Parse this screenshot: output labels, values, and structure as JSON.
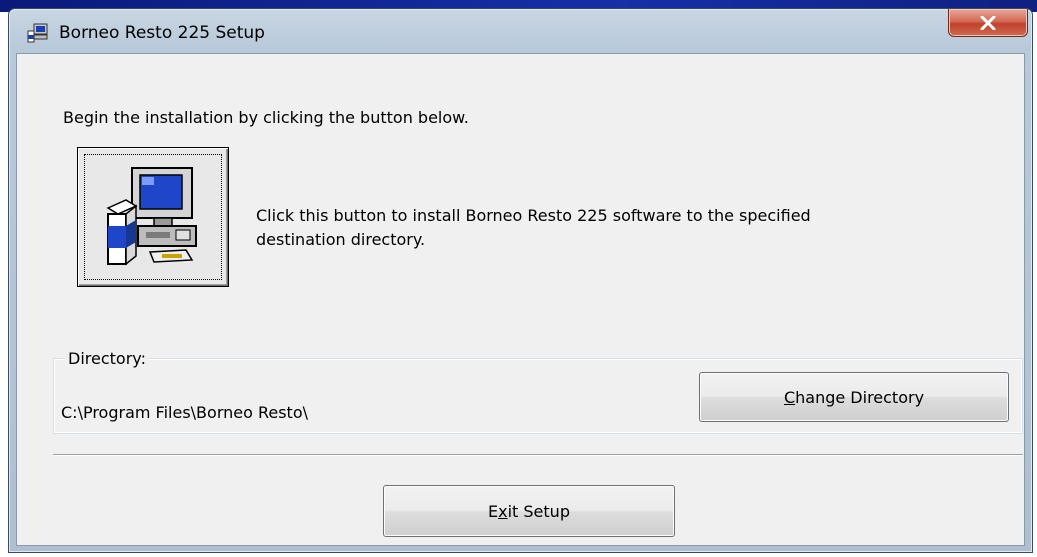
{
  "window": {
    "title": "Borneo Resto 225 Setup",
    "close_label": "x"
  },
  "intro_text": "Begin the installation by clicking the button below.",
  "install": {
    "description_line1": "Click this button to install Borneo Resto 225 software to the specified",
    "description_line2": "destination directory.",
    "icon": "setup-computer-icon"
  },
  "directory": {
    "legend": "Directory:",
    "path": "C:\\Program Files\\Borneo Resto\\",
    "change_button": {
      "prefix": "",
      "accel": "C",
      "rest": "hange Directory"
    }
  },
  "exit_button": {
    "prefix": "E",
    "accel": "x",
    "rest": "it Setup"
  },
  "colors": {
    "window_frame": "#b8c9da",
    "client_bg": "#f0f0f0",
    "close_button": "#c0432c",
    "desktop": "#1530a8"
  }
}
